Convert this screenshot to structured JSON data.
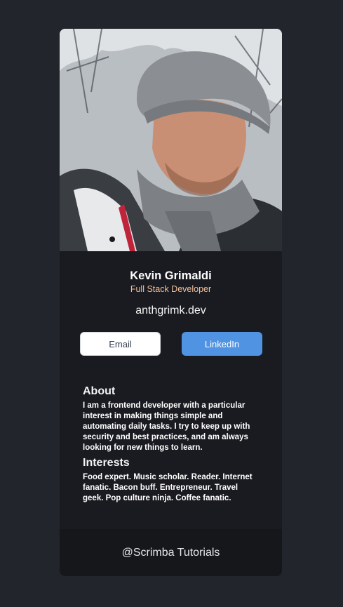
{
  "profile": {
    "photo_icon": "profile-photo",
    "name": "Kevin Grimaldi",
    "role": "Full Stack Developer",
    "website": "anthgrimk.dev"
  },
  "buttons": {
    "email_label": "Email",
    "linkedin_label": "LinkedIn"
  },
  "about": {
    "heading": "About",
    "text": "I am a frontend developer with a particular interest in making things simple and automating daily tasks. I try to keep up with security and best practices, and am always looking for new things to learn."
  },
  "interests": {
    "heading": "Interests",
    "text": "Food expert. Music scholar. Reader. Internet fanatic. Bacon buff. Entrepreneur. Travel geek. Pop culture ninja. Coffee fanatic."
  },
  "footer": {
    "text": "@Scrimba Tutorials"
  },
  "colors": {
    "page_bg": "#23252c",
    "card_bg": "#1a1b21",
    "accent_role": "#f3bf99",
    "linkedin_blue": "#5093e2",
    "footer_bg": "#16171b"
  }
}
